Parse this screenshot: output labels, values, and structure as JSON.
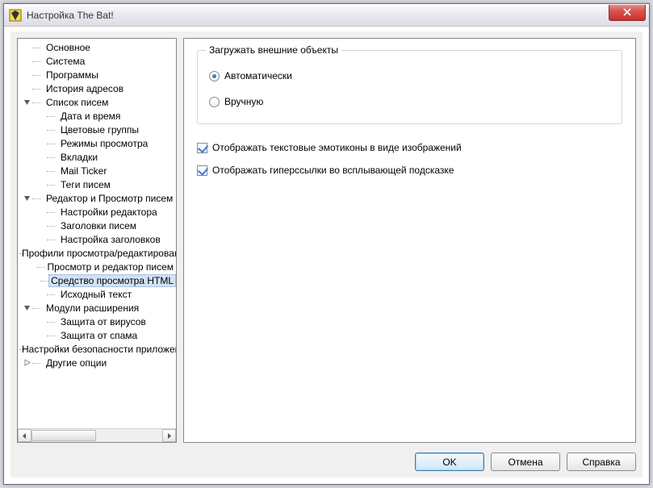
{
  "window": {
    "title": "Настройка The Bat!"
  },
  "tree": [
    {
      "level": 0,
      "toggle": "none",
      "label": "Основное"
    },
    {
      "level": 0,
      "toggle": "none",
      "label": "Система"
    },
    {
      "level": 0,
      "toggle": "none",
      "label": "Программы"
    },
    {
      "level": 0,
      "toggle": "none",
      "label": "История адресов"
    },
    {
      "level": 0,
      "toggle": "open",
      "label": "Список писем"
    },
    {
      "level": 1,
      "toggle": "none",
      "label": "Дата и время"
    },
    {
      "level": 1,
      "toggle": "none",
      "label": "Цветовые группы"
    },
    {
      "level": 1,
      "toggle": "none",
      "label": "Режимы просмотра"
    },
    {
      "level": 1,
      "toggle": "none",
      "label": "Вкладки"
    },
    {
      "level": 1,
      "toggle": "none",
      "label": "Mail Ticker"
    },
    {
      "level": 1,
      "toggle": "none",
      "label": "Теги писем"
    },
    {
      "level": 0,
      "toggle": "open",
      "label": "Редактор и Просмотр писем"
    },
    {
      "level": 1,
      "toggle": "none",
      "label": "Настройки редактора"
    },
    {
      "level": 1,
      "toggle": "none",
      "label": "Заголовки писем"
    },
    {
      "level": 1,
      "toggle": "none",
      "label": "Настройка заголовков"
    },
    {
      "level": 1,
      "toggle": "none",
      "label": "Профили просмотра/редактирования"
    },
    {
      "level": 1,
      "toggle": "none",
      "label": "Просмотр и редактор писем"
    },
    {
      "level": 1,
      "toggle": "none",
      "label": "Средство просмотра HTML",
      "selected": true
    },
    {
      "level": 1,
      "toggle": "none",
      "label": "Исходный текст"
    },
    {
      "level": 0,
      "toggle": "open",
      "label": "Модули расширения"
    },
    {
      "level": 1,
      "toggle": "none",
      "label": "Защита от вирусов"
    },
    {
      "level": 1,
      "toggle": "none",
      "label": "Защита от спама"
    },
    {
      "level": 0,
      "toggle": "none",
      "label": "Настройки безопасности приложения"
    },
    {
      "level": 0,
      "toggle": "closed",
      "label": "Другие опции"
    }
  ],
  "content": {
    "group_title": "Загружать внешние объекты",
    "radio_auto": "Автоматически",
    "radio_manual": "Вручную",
    "check_emoticons": "Отображать текстовые эмотиконы в виде изображений",
    "check_hyperlinks": "Отображать гиперссылки во всплывающей подсказке"
  },
  "buttons": {
    "ok": "OK",
    "cancel": "Отмена",
    "help": "Справка"
  }
}
